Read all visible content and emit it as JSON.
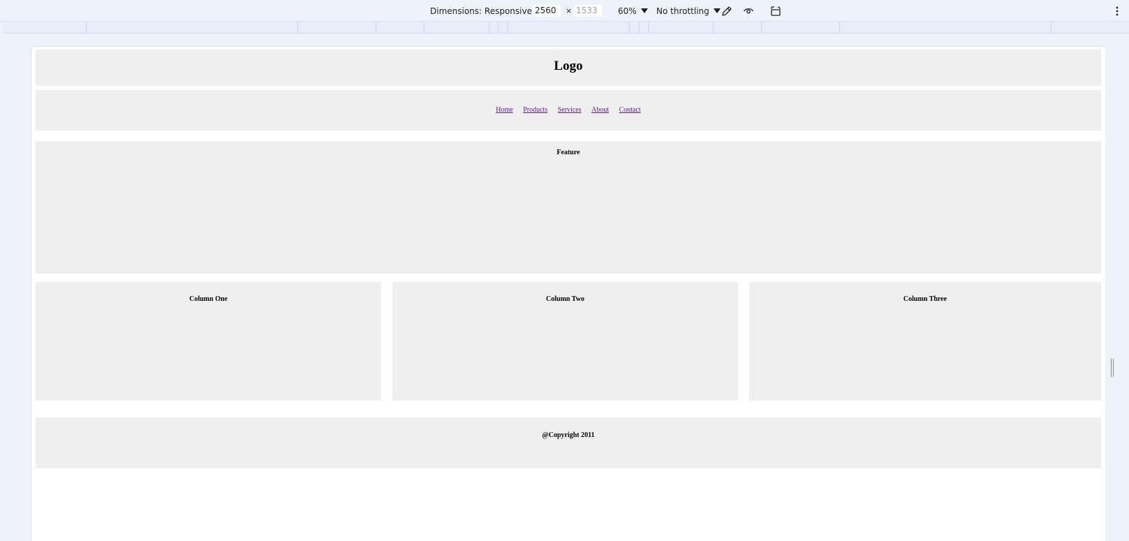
{
  "toolbar": {
    "dimensions_label": "Dimensions: Responsive",
    "width_value": "2560",
    "times_sign": "×",
    "height_value": "1533",
    "zoom_label": "60%",
    "throttling_label": "No throttling"
  },
  "page": {
    "logo": "Logo",
    "nav": [
      "Home",
      "Products",
      "Services",
      "About",
      "Contact"
    ],
    "feature_title": "Feature",
    "columns": [
      "Column One",
      "Column Two",
      "Column Three"
    ],
    "footer": "@Copyright 2011"
  },
  "colors": {
    "devtools_bg": "#eef3fb",
    "box_bg": "#efefef",
    "link": "#551a8b"
  }
}
